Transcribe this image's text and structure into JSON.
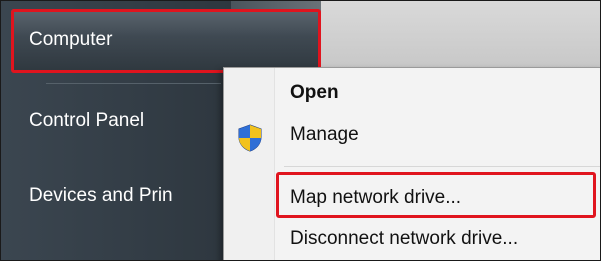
{
  "start_menu": {
    "items": [
      {
        "label": "Computer"
      },
      {
        "label": "Control Panel"
      },
      {
        "label": "Devices and Prin"
      }
    ]
  },
  "context_menu": {
    "items": [
      {
        "label": "Open",
        "bold": true
      },
      {
        "label": "Manage",
        "icon": "uac-shield-icon"
      },
      {
        "label": "Map network drive..."
      },
      {
        "label": "Disconnect network drive..."
      }
    ]
  },
  "colors": {
    "highlight": "#e0141e",
    "start_menu_bg": "#333d46",
    "menu_bg": "#f3f3f3"
  }
}
